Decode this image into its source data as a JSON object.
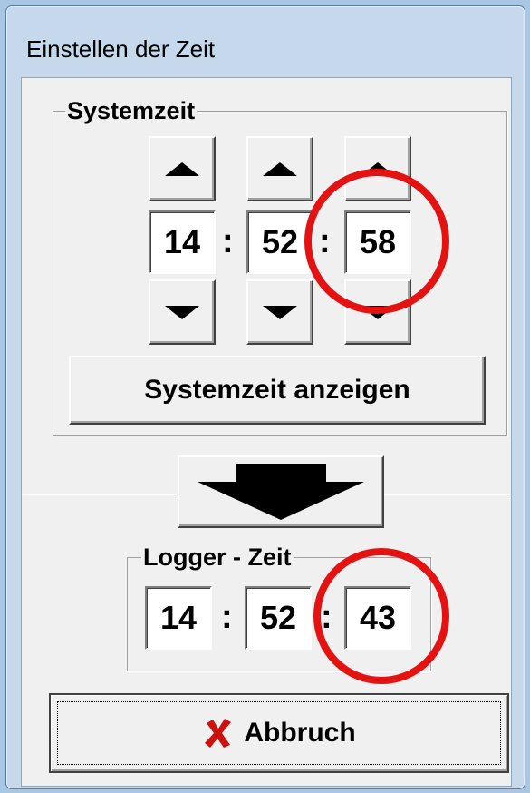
{
  "window": {
    "title": "Einstellen der Zeit"
  },
  "systemzeit": {
    "legend": "Systemzeit",
    "hours": "14",
    "minutes": "52",
    "seconds": "58",
    "separator": ":",
    "show_button_label": "Systemzeit anzeigen"
  },
  "logger": {
    "legend": "Logger - Zeit",
    "hours": "14",
    "minutes": "52",
    "seconds": "43",
    "separator": ":"
  },
  "cancel_button": {
    "label": "Abbruch",
    "icon": "x-icon"
  },
  "colors": {
    "highlight_circle": "#e51212",
    "cancel_x": "#cc1111"
  }
}
